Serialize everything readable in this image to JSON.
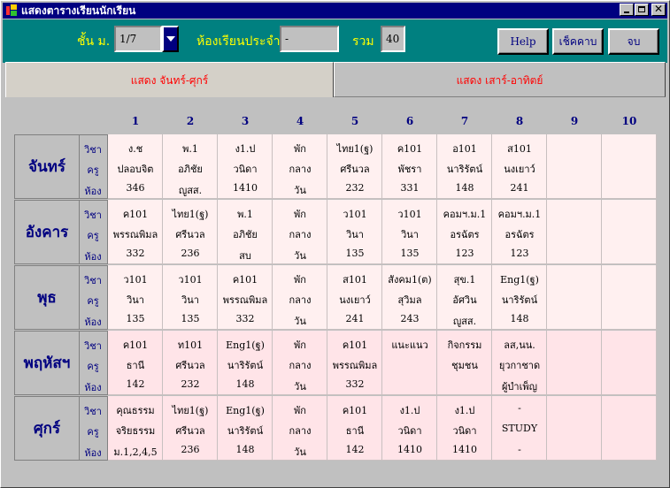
{
  "window": {
    "title": "แสดงตารางเรียนนักเรียน",
    "icon": "app-icon"
  },
  "toolbar": {
    "grade_label": "ชั้น ม.",
    "grade_value": "1/7",
    "homeroom_label": "ห้องเรียนประจำ",
    "homeroom_value": "-",
    "total_label": "รวม",
    "total_value": "40",
    "help_label": "Help",
    "check_period_label": "เช็คคาบ",
    "close_label": "จบ"
  },
  "tabs": [
    {
      "label": "แสดง จันทร์-ศุกร์",
      "active": true
    },
    {
      "label": "แสดง เสาร์-อาทิตย์",
      "active": false
    }
  ],
  "periods": [
    "1",
    "2",
    "3",
    "4",
    "5",
    "6",
    "7",
    "8",
    "9",
    "10"
  ],
  "row_kinds": [
    "วิชา",
    "ครู",
    "ห้อง"
  ],
  "days": [
    {
      "name": "จันทร์",
      "bg": "#fff0f0",
      "cells": [
        [
          "ง.ช",
          "ปลอบจิต",
          "346"
        ],
        [
          "พ.1",
          "อภิชัย",
          "ญูสส."
        ],
        [
          "ง1.ป",
          "วนิดา",
          "1410"
        ],
        [
          "พัก",
          "กลาง",
          "วัน"
        ],
        [
          "ไทย1(ฐ)",
          "ศรีนวล",
          "232"
        ],
        [
          "ค101",
          "พัชรา",
          "331"
        ],
        [
          "อ101",
          "นาริรัตน์",
          "148"
        ],
        [
          "ส101",
          "นงเยาว์",
          "241"
        ],
        [
          "",
          "",
          ""
        ],
        [
          "",
          "",
          ""
        ]
      ]
    },
    {
      "name": "อังคาร",
      "bg": "#fff0f0",
      "cells": [
        [
          "ค101",
          "พรรณพิมล",
          "332"
        ],
        [
          "ไทย1(ฐ)",
          "ศรีนวล",
          "236"
        ],
        [
          "พ.1",
          "อภิชัย",
          "สบ"
        ],
        [
          "พัก",
          "กลาง",
          "วัน"
        ],
        [
          "ว101",
          "วินา",
          "135"
        ],
        [
          "ว101",
          "วินา",
          "135"
        ],
        [
          "คอมฯ.ม.1",
          "อรฉัตร",
          "123"
        ],
        [
          "คอมฯ.ม.1",
          "อรฉัตร",
          "123"
        ],
        [
          "",
          "",
          ""
        ],
        [
          "",
          "",
          ""
        ]
      ]
    },
    {
      "name": "พุธ",
      "bg": "#fff0f0",
      "cells": [
        [
          "ว101",
          "วินา",
          "135"
        ],
        [
          "ว101",
          "วินา",
          "135"
        ],
        [
          "ค101",
          "พรรณพิมล",
          "332"
        ],
        [
          "พัก",
          "กลาง",
          "วัน"
        ],
        [
          "ส101",
          "นงเยาว์",
          "241"
        ],
        [
          "สังคม1(ต)",
          "สุวิมล",
          "243"
        ],
        [
          "สุข.1",
          "อัศวิน",
          "ญูสส."
        ],
        [
          "Eng1(ฐ)",
          "นาริรัตน์",
          "148"
        ],
        [
          "",
          "",
          ""
        ],
        [
          "",
          "",
          ""
        ]
      ]
    },
    {
      "name": "พฤหัสฯ",
      "bg": "#ffe4e8",
      "cells": [
        [
          "ค101",
          "ธานี",
          "142"
        ],
        [
          "ท101",
          "ศรีนวล",
          "232"
        ],
        [
          "Eng1(ฐ)",
          "นาริรัตน์",
          "148"
        ],
        [
          "พัก",
          "กลาง",
          "วัน"
        ],
        [
          "ค101",
          "พรรณพิมล",
          "332"
        ],
        [
          "แนะแนว",
          "",
          ""
        ],
        [
          "กิจกรรม",
          "ชุมชน",
          ""
        ],
        [
          "ลส,นน.",
          "ยุวกาชาด",
          "ผู้บำเพ็ญ"
        ],
        [
          "",
          "",
          ""
        ],
        [
          "",
          "",
          ""
        ]
      ]
    },
    {
      "name": "ศุกร์",
      "bg": "#ffe4e8",
      "cells": [
        [
          "คุณธรรม",
          "จริยธรรม",
          "ม.1,2,4,5"
        ],
        [
          "ไทย1(ฐ)",
          "ศรีนวล",
          "236"
        ],
        [
          "Eng1(ฐ)",
          "นาริรัตน์",
          "148"
        ],
        [
          "พัก",
          "กลาง",
          "วัน"
        ],
        [
          "ค101",
          "ธานี",
          "142"
        ],
        [
          "ง1.ป",
          "วนิดา",
          "1410"
        ],
        [
          "ง1.ป",
          "วนิดา",
          "1410"
        ],
        [
          "-",
          "STUDY",
          "-"
        ],
        [
          "",
          "",
          ""
        ],
        [
          "",
          "",
          ""
        ]
      ]
    }
  ]
}
